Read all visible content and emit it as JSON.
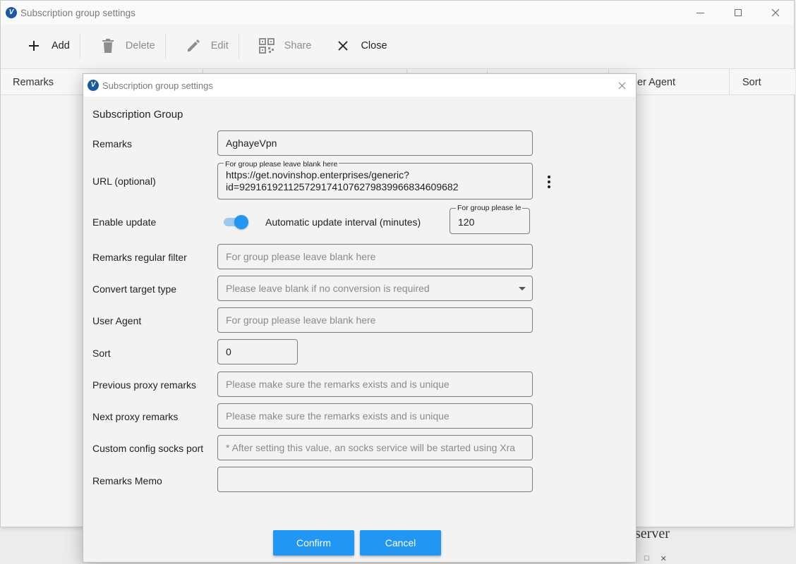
{
  "main_window": {
    "title": "Subscription group settings",
    "toolbar": {
      "add": "Add",
      "delete": "Delete",
      "edit": "Edit",
      "share": "Share",
      "close": "Close"
    },
    "table_headers": {
      "remarks": "Remarks",
      "user_agent_partial": "er Agent",
      "sort": "Sort"
    },
    "behind_text": "server"
  },
  "dialog": {
    "title": "Subscription group settings",
    "section_title": "Subscription Group",
    "remarks": {
      "label": "Remarks",
      "value": "AghayeVpn"
    },
    "url": {
      "label": "URL (optional)",
      "hint": "For group please leave blank here",
      "value_line1": "https://get.novinshop.enterprises/generic?",
      "value_line2": "id=929161921125729174107627983996683460968​2"
    },
    "enable_update": {
      "label": "Enable update",
      "enabled": true,
      "interval_label": "Automatic update interval (minutes)",
      "interval_hint": "For group please le",
      "interval_value": "120"
    },
    "remarks_filter": {
      "label": "Remarks regular filter",
      "placeholder": "For group please leave blank here"
    },
    "convert_target": {
      "label": "Convert target type",
      "placeholder": "Please leave blank if no conversion is required"
    },
    "user_agent": {
      "label": "User Agent",
      "placeholder": "For group please leave blank here"
    },
    "sort": {
      "label": "Sort",
      "value": "0"
    },
    "prev_proxy": {
      "label": "Previous proxy remarks",
      "placeholder": "Please make sure the remarks exists and is unique"
    },
    "next_proxy": {
      "label": "Next proxy remarks",
      "placeholder": "Please make sure the remarks exists and is unique"
    },
    "socks_port": {
      "label": "Custom config socks port",
      "placeholder": "* After setting this value, an socks service will be started using Xra"
    },
    "memo": {
      "label": "Remarks Memo",
      "value": ""
    },
    "confirm": "Confirm",
    "cancel": "Cancel"
  },
  "colors": {
    "accent": "#2196f3",
    "logo": "#1a5aa0"
  }
}
